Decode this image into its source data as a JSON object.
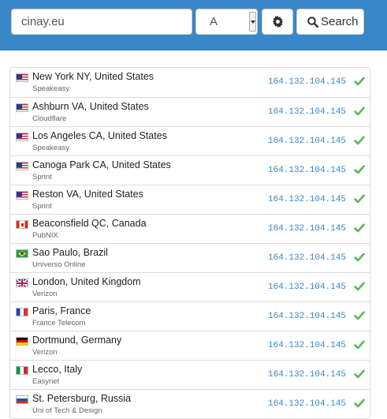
{
  "search": {
    "host_value": "cinay.eu",
    "record_type": "A",
    "button_label": "Search"
  },
  "colors": {
    "header_bg": "#3a87c8",
    "ip_text": "#3a87c8",
    "status_ok": "#5cb85c"
  },
  "results": [
    {
      "flag": "us",
      "location": "New York NY, United States",
      "isp": "Speakeasy",
      "ip": "164.132.104.145",
      "status": "ok"
    },
    {
      "flag": "us",
      "location": "Ashburn VA, United States",
      "isp": "Cloudflare",
      "ip": "164.132.104.145",
      "status": "ok"
    },
    {
      "flag": "us",
      "location": "Los Angeles CA, United States",
      "isp": "Speakeasy",
      "ip": "164.132.104.145",
      "status": "ok"
    },
    {
      "flag": "us",
      "location": "Canoga Park CA, United States",
      "isp": "Sprint",
      "ip": "164.132.104.145",
      "status": "ok"
    },
    {
      "flag": "us",
      "location": "Reston VA, United States",
      "isp": "Sprint",
      "ip": "164.132.104.145",
      "status": "ok"
    },
    {
      "flag": "ca",
      "location": "Beaconsfield QC, Canada",
      "isp": "PubNIX",
      "ip": "164.132.104.145",
      "status": "ok"
    },
    {
      "flag": "br",
      "location": "Sao Paulo, Brazil",
      "isp": "Universo Online",
      "ip": "164.132.104.145",
      "status": "ok"
    },
    {
      "flag": "gb",
      "location": "London, United Kingdom",
      "isp": "Verizon",
      "ip": "164.132.104.145",
      "status": "ok"
    },
    {
      "flag": "fr",
      "location": "Paris, France",
      "isp": "France Telecom",
      "ip": "164.132.104.145",
      "status": "ok"
    },
    {
      "flag": "de",
      "location": "Dortmund, Germany",
      "isp": "Verizon",
      "ip": "164.132.104.145",
      "status": "ok"
    },
    {
      "flag": "it",
      "location": "Lecco, Italy",
      "isp": "Easynet",
      "ip": "164.132.104.145",
      "status": "ok"
    },
    {
      "flag": "ru",
      "location": "St. Petersburg, Russia",
      "isp": "Uni of Tech & Design",
      "ip": "164.132.104.145",
      "status": "ok"
    }
  ]
}
